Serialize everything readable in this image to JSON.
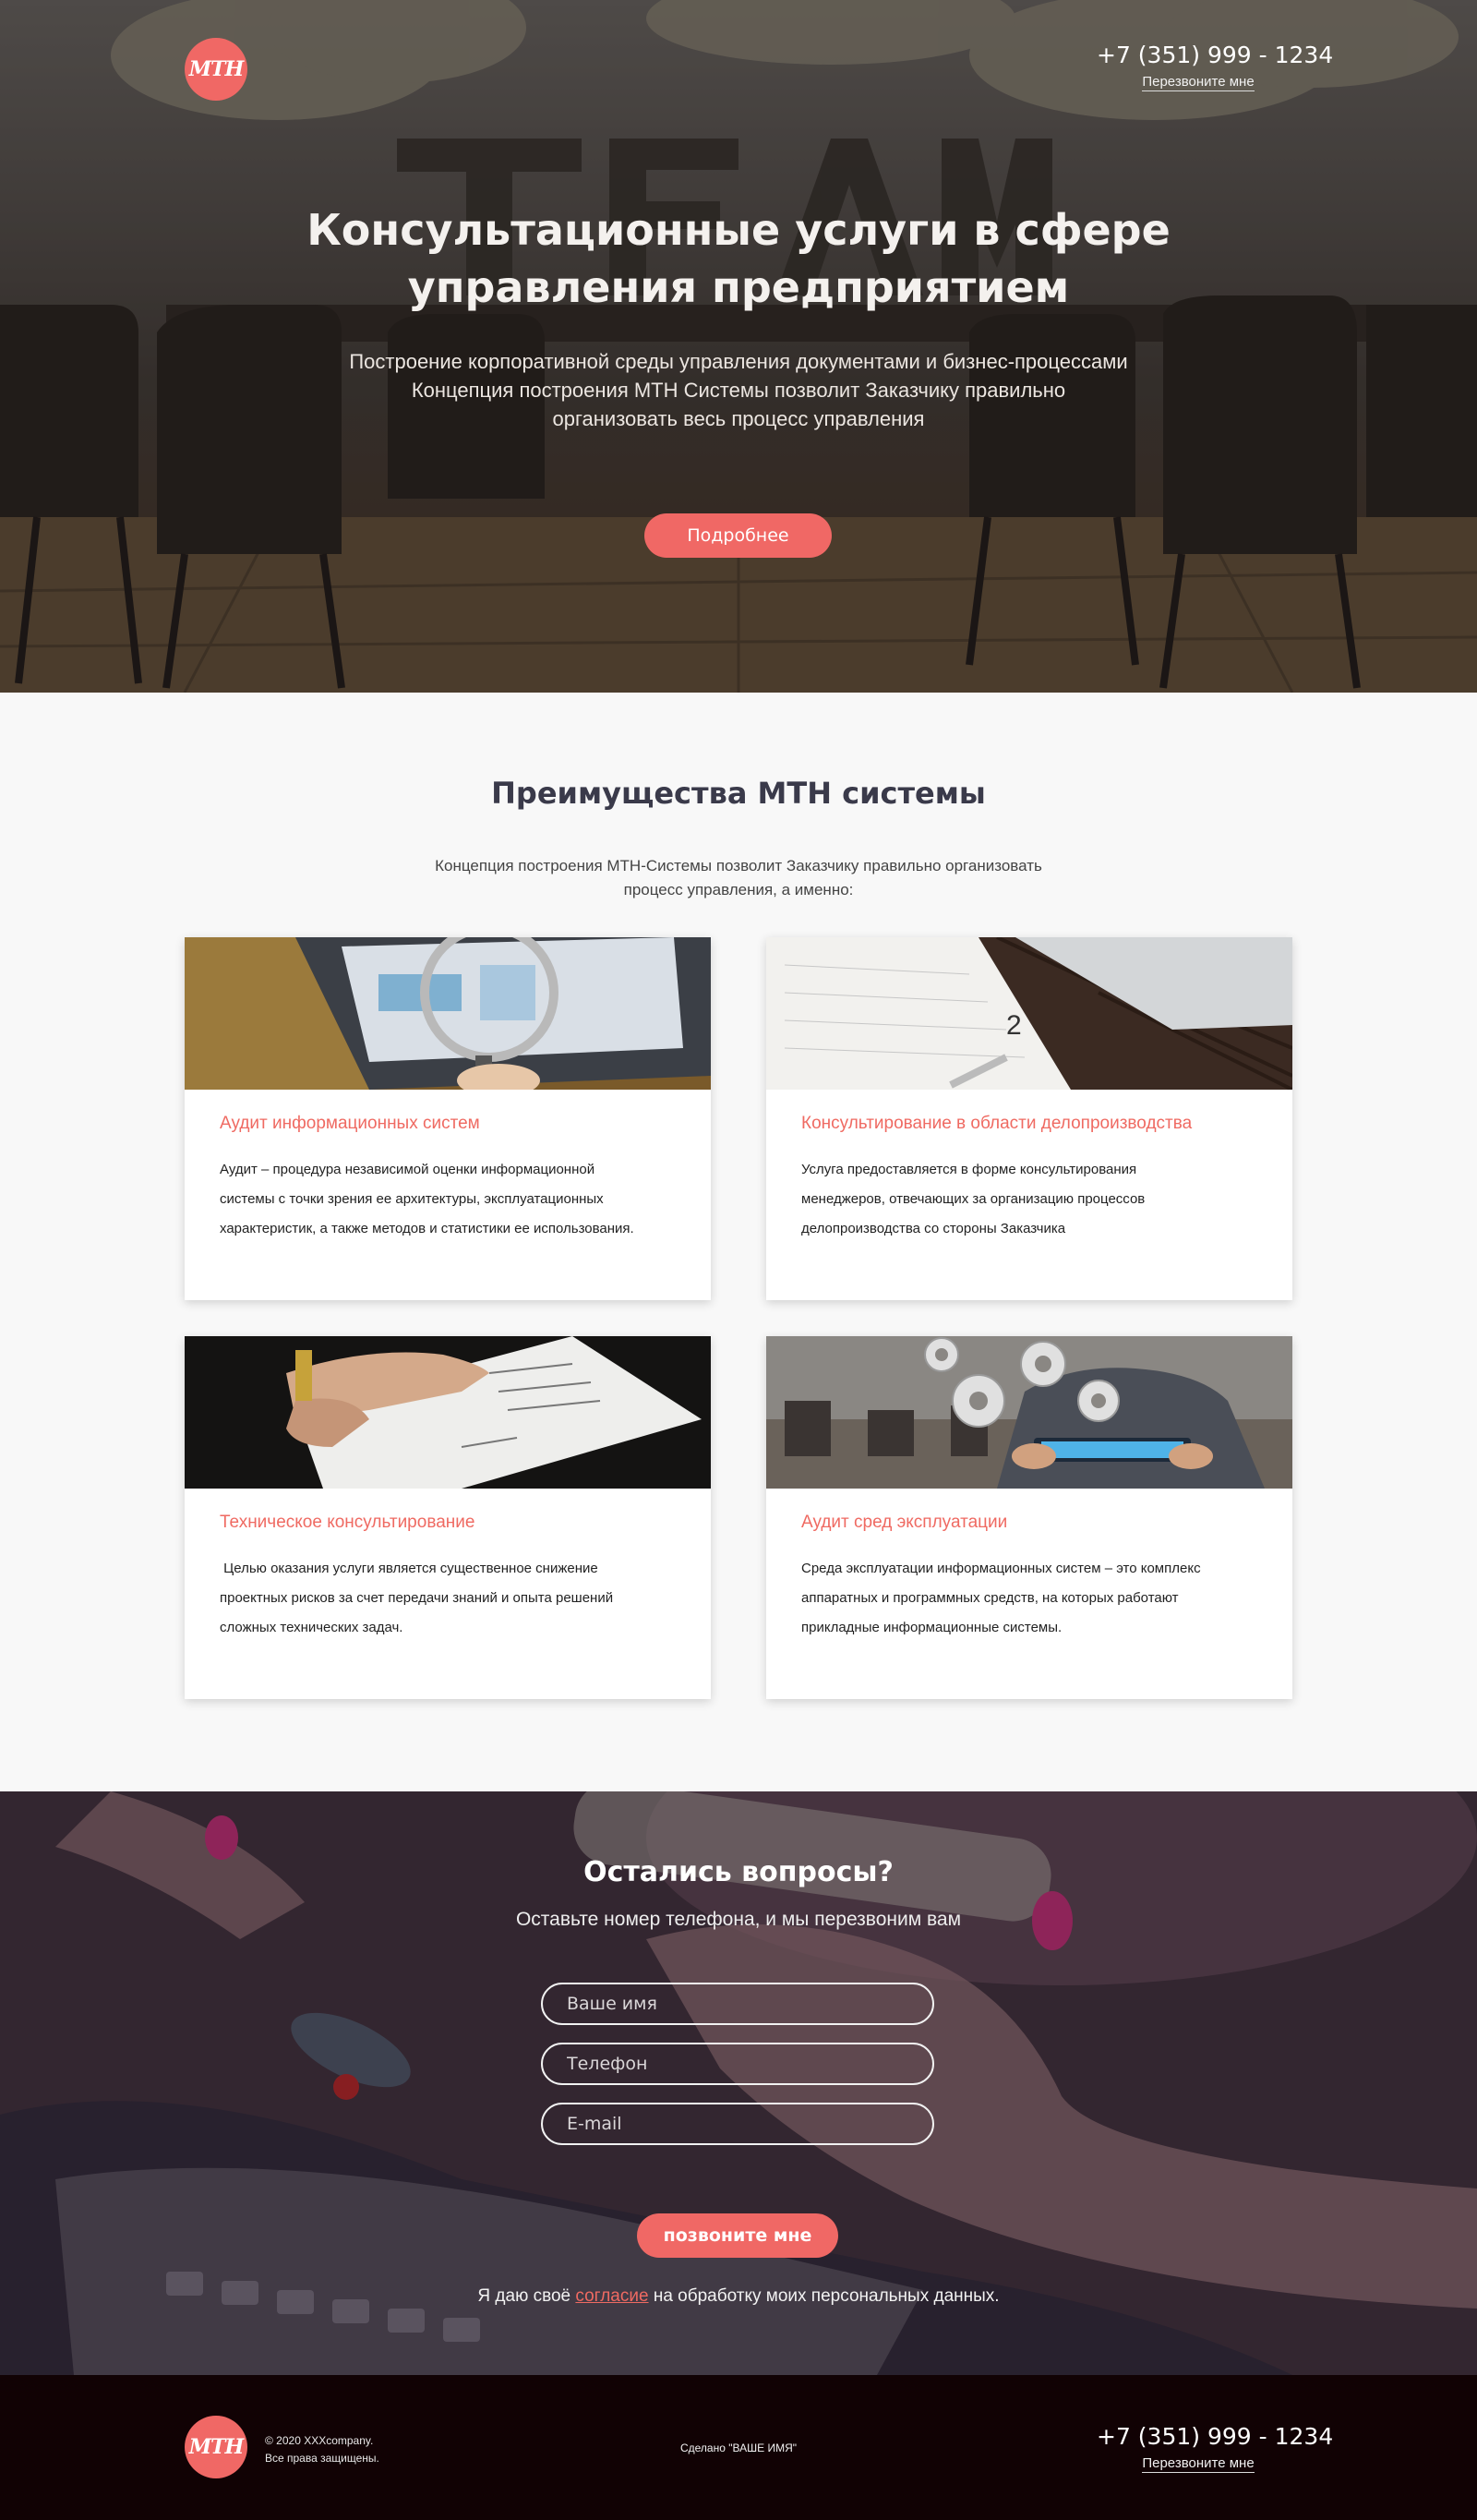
{
  "header": {
    "logo_text": "МТН",
    "phone": "+7 (351) 999 - 1234",
    "callback_link": "Перезвоните мне"
  },
  "hero": {
    "title_line1": "Консультационные услуги в сфере",
    "title_line2": "управления предприятием",
    "description_lines": [
      "Построение корпоративной среды управления документами и бизнес-процессами",
      "Концепция построения МТН Системы позволит Заказчику правильно",
      "организовать весь процесс управления"
    ],
    "button": "Подробнее"
  },
  "advantages": {
    "title": "Преимущества МТН системы",
    "subtitle_lines": [
      "Концепция построения МТН-Системы позволит Заказчику правильно организовать",
      "процесс управления, а именно:"
    ],
    "cards": [
      {
        "title": "Аудит информационных систем",
        "text_lines": [
          "Аудит – процедура независимой оценки информационной",
          "системы с точки зрения ее архитектуры, эксплуатационных",
          "характеристик, а также методов и статистики ее использования."
        ]
      },
      {
        "title": "Консультирование в области делопроизводства",
        "text_lines": [
          "Услуга предоставляется в форме консультирования",
          "менеджеров, отвечающих за организацию процессов",
          "делопроизводства со стороны Заказчика"
        ]
      },
      {
        "title": "Техническое консультирование",
        "text_lines": [
          " Целью оказания услуги является существенное снижение",
          "проектных рисков за счет передачи знаний и опыта решений",
          "сложных технических задач."
        ]
      },
      {
        "title": "Аудит сред эксплуатации",
        "text_lines": [
          "Среда эксплуатации информационных систем – это комплекс",
          "аппаратных и программных средств, на которых работают",
          "прикладные информационные системы."
        ]
      }
    ]
  },
  "contact_form": {
    "title": "Остались вопросы?",
    "subtitle": "Оставьте номер телефона, и мы перезвоним вам",
    "name_placeholder": "Ваше имя",
    "phone_placeholder": "Телефон",
    "email_placeholder": "E-mail",
    "button": "позвоните мне",
    "consent_before": "Я даю своё ",
    "consent_link": "согласие",
    "consent_after": " на обработку моих персональных данных."
  },
  "footer": {
    "logo_text": "МТН",
    "copyright_line1": "© 2020 XXXcompany.",
    "copyright_line2": "Все права защищены.",
    "made_by": "Сделано \"ВАШЕ ИМЯ\"",
    "phone": "+7 (351) 999 - 1234",
    "callback_link": "Перезвоните мне"
  },
  "colors": {
    "accent": "#f06865",
    "card_title": "#ef6a62",
    "footer_bg": "#110204",
    "section_bg": "#f8f8f8"
  }
}
